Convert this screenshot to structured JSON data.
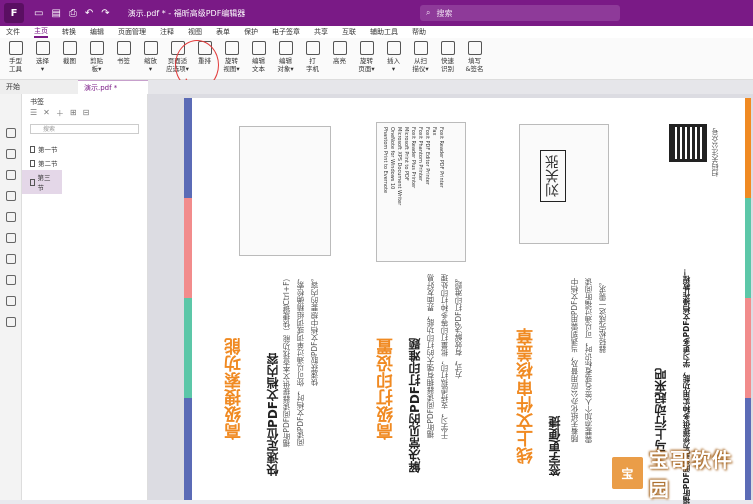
{
  "titlebar": {
    "logo": "F",
    "doc_title": "演示.pdf * - 福昕高级PDF编辑器",
    "search_placeholder": "搜索"
  },
  "menu": [
    "文件",
    "主页",
    "转换",
    "编辑",
    "页面管理",
    "注释",
    "视图",
    "表单",
    "保护",
    "电子签章",
    "共享",
    "互联",
    "辅助工具",
    "帮助"
  ],
  "ribbon": [
    {
      "label": "手型\n工具",
      "icon": "hand-icon"
    },
    {
      "label": "选择\n▾",
      "icon": "cursor-icon"
    },
    {
      "label": "截图",
      "icon": "camera-icon"
    },
    {
      "label": "剪贴\n板▾",
      "icon": "clipboard-icon"
    },
    {
      "label": "书签",
      "icon": "bookmark-icon"
    },
    {
      "label": "缩放\n▾",
      "icon": "zoom-icon"
    },
    {
      "label": "页面适\n应选项▾",
      "icon": "fit-page-icon"
    },
    {
      "label": "重排",
      "icon": "reflow-icon"
    },
    {
      "label": "旋转\n视图▾",
      "icon": "rotate-icon"
    },
    {
      "label": "编辑\n文本",
      "icon": "edit-text-icon"
    },
    {
      "label": "编辑\n对象▾",
      "icon": "edit-object-icon"
    },
    {
      "label": "打\n字机",
      "icon": "typewriter-icon"
    },
    {
      "label": "高亮",
      "icon": "highlight-icon"
    },
    {
      "label": "旋转\n页面▾",
      "icon": "rotate-page-icon"
    },
    {
      "label": "插入\n▾",
      "icon": "insert-icon"
    },
    {
      "label": "从扫\n描仪▾",
      "icon": "scanner-icon"
    },
    {
      "label": "快速\n识别",
      "icon": "ocr-icon"
    },
    {
      "label": "填写\n&签名",
      "icon": "sign-icon"
    }
  ],
  "tabs": {
    "start": "开始",
    "doc": "演示.pdf *"
  },
  "bookmarks": {
    "header": "书签",
    "search_placeholder": "搜索",
    "items": [
      "第一节",
      "第二节",
      "第三节"
    ]
  },
  "page": {
    "col1": {
      "title": "高级搜索功能",
      "subtitle": "快速定位PDF文档内容",
      "body": [
        "福昕PDF阅读器提供文本查找功能（快捷键Ctrl+F）",
        "阅读PDF文档时，你可以通过单词或词组精确检索，",
        "快速获取PDF文档中想要的内容。"
      ]
    },
    "col2": {
      "title": "高级打印设置",
      "subtitle": "解决常见的PDF打印难题",
      "body": [
        "福昕PDF阅读器拥有强大的打印功能，界面友好易",
        "于学习，支持虚拟打印，批量打印等多种打印处理",
        "方式，有效解决PDF打印难题。"
      ]
    },
    "col3": {
      "title": "线上文件审核盖章",
      "subtitle": "签字更便捷",
      "body": [
        "随着无纸化办公应用普及，当遇到需用PDF文档中",
        "需要添加个人签名或者标识时，可以通过福昕阅读",
        "器轻松完成这一需求。"
      ]
    },
    "col4": {
      "title": "马上行动起来吧",
      "subtitle": "扫码关注公众号",
      "body": [
        "福昕PDF阅读器为您提供多种实用功能，学习更多PDF文档操作教程！"
      ]
    },
    "printers": [
      "Foxit Reader PDF Printer",
      "Fax",
      "Foxit PDF Editor Printer",
      "Foxit Phantom Printer",
      "Foxit Reader Plus Printer",
      "Microsoft Print to PDF",
      "Microsoft XPS Document Writer",
      "OneNote for Windows 10",
      "Phantom Print to Evernote"
    ],
    "stamp_name": "刘关张"
  },
  "watermark": "宝哥软件园",
  "colors": {
    "brand": "#7a1a86",
    "orange": "#f08a22",
    "stripe_blue": "#5b6bb6",
    "stripe_pink": "#f28c8c",
    "stripe_teal": "#5cc7a8",
    "annotation_red": "#e23a3a"
  }
}
